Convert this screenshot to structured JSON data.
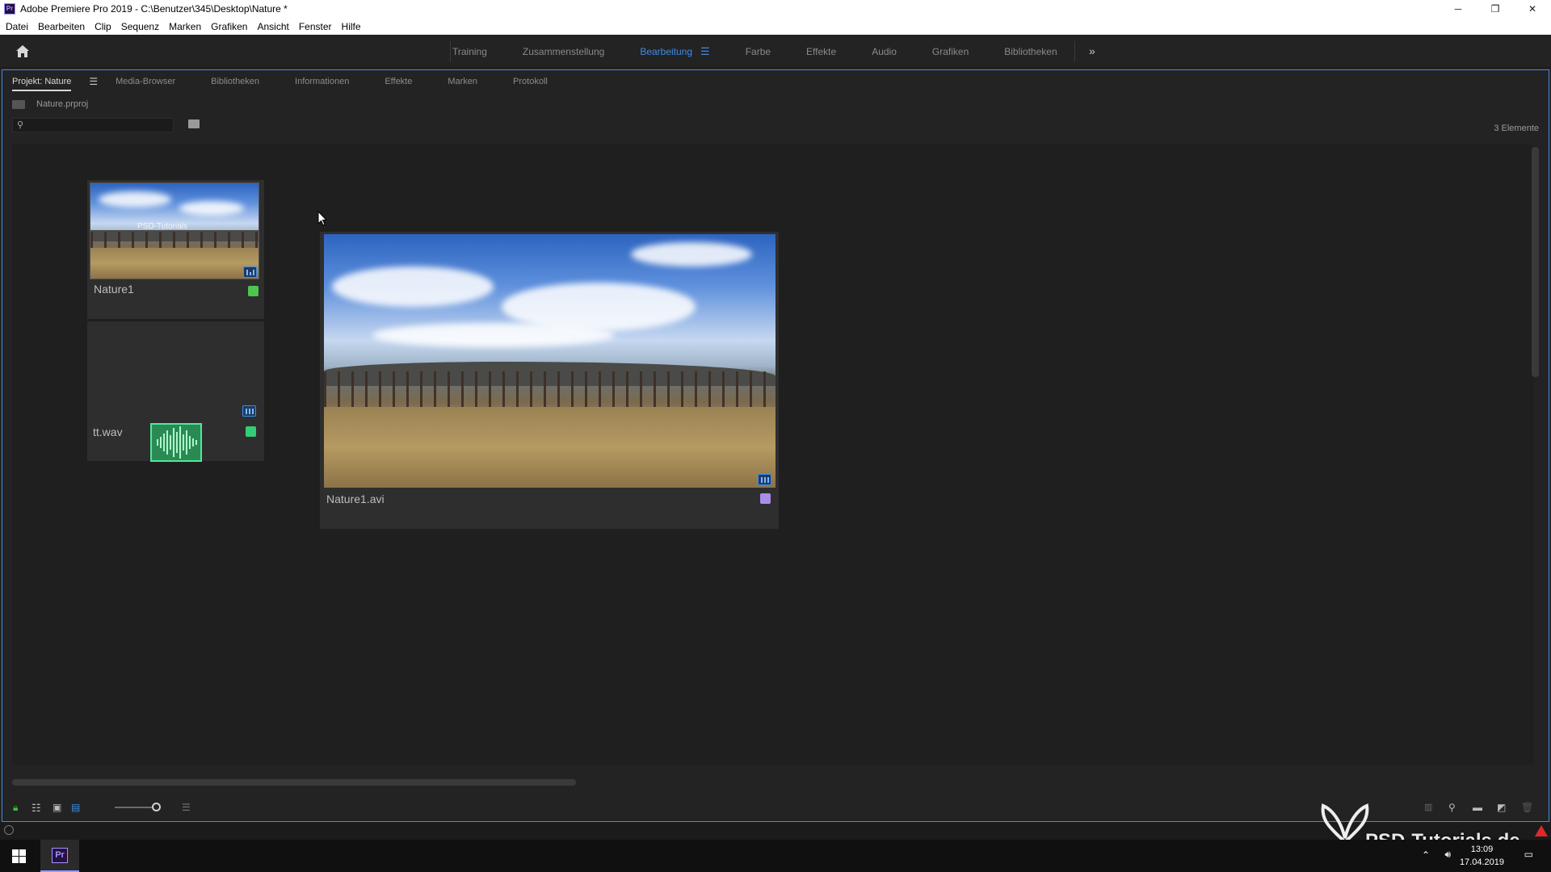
{
  "window": {
    "title": "Adobe Premiere Pro 2019 - C:\\Benutzer\\345\\Desktop\\Nature *",
    "app_icon_text": "Pr",
    "minimize": "─",
    "restore": "❐",
    "close": "✕"
  },
  "menu": [
    "Datei",
    "Bearbeiten",
    "Clip",
    "Sequenz",
    "Marken",
    "Grafiken",
    "Ansicht",
    "Fenster",
    "Hilfe"
  ],
  "workspaces": {
    "items": [
      "Training",
      "Zusammenstellung",
      "Bearbeitung",
      "Farbe",
      "Effekte",
      "Audio",
      "Grafiken",
      "Bibliotheken"
    ],
    "active": "Bearbeitung",
    "more": "»"
  },
  "panel": {
    "tabs": [
      "Projekt: Nature",
      "Media-Browser",
      "Bibliotheken",
      "Informationen",
      "Effekte",
      "Marken",
      "Protokoll"
    ],
    "active_tab": "Projekt: Nature",
    "project_file": "Nature.prproj",
    "search_placeholder": "",
    "item_count": "3 Elemente"
  },
  "items": [
    {
      "name": "Nature1",
      "label_color": "#4fc44f",
      "type": "sequence"
    },
    {
      "name": "tt.wav",
      "label_color": "#33cc77",
      "type": "audio"
    },
    {
      "name": "Nature1.avi",
      "label_color": "#a98ee8",
      "type": "video"
    }
  ],
  "thumb_overlay_text": "PSD-Tutorials",
  "taskbar": {
    "time": "13:09",
    "date": "17.04.2019"
  },
  "watermark": "PSD-Tutorials.de",
  "colors": {
    "accent": "#3d8ce6",
    "panel_bg": "#232323",
    "card_bg": "#2e2e2e"
  }
}
